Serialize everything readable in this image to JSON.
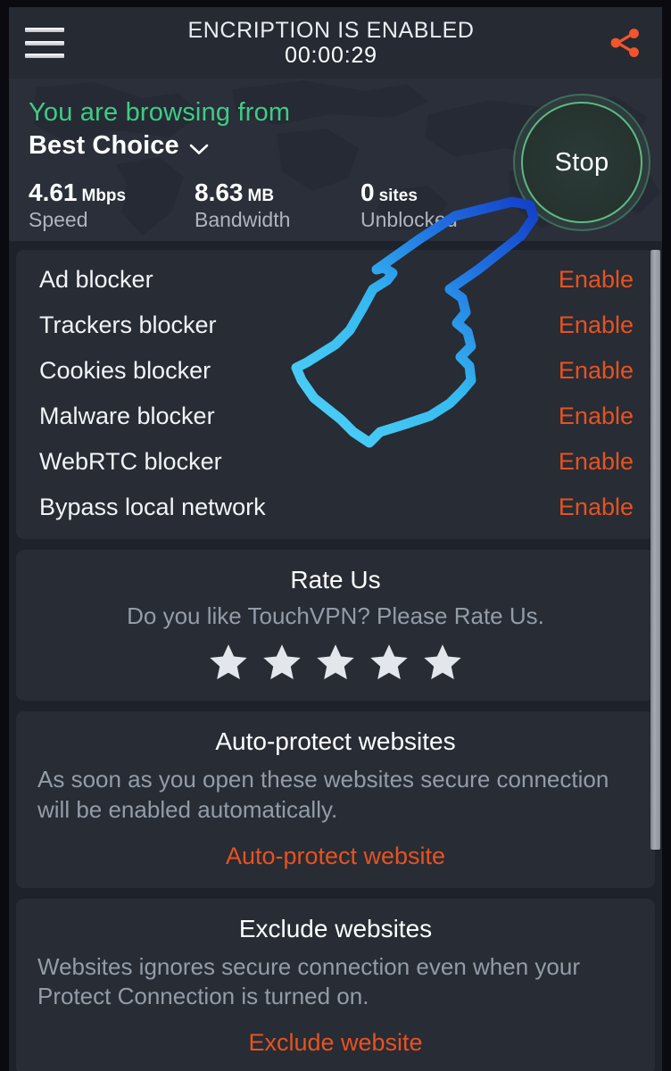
{
  "topbar": {
    "menu_icon": "hamburger-menu-icon",
    "title": "ENCRIPTION IS ENABLED",
    "timer": "00:00:29",
    "share_icon": "share-icon"
  },
  "status": {
    "browsing_from_label": "You are browsing from",
    "location": "Best Choice",
    "chevron_icon": "chevron-down-icon",
    "stop_button": "Stop",
    "stats": [
      {
        "value": "4.61",
        "unit": "Mbps",
        "label": "Speed"
      },
      {
        "value": "8.63",
        "unit": "MB",
        "label": "Bandwidth"
      },
      {
        "value": "0",
        "unit": "sites",
        "label": "Unblocked"
      }
    ]
  },
  "blockers": [
    {
      "name": "Ad blocker",
      "action": "Enable"
    },
    {
      "name": "Trackers blocker",
      "action": "Enable"
    },
    {
      "name": "Cookies blocker",
      "action": "Enable"
    },
    {
      "name": "Malware blocker",
      "action": "Enable"
    },
    {
      "name": "WebRTC blocker",
      "action": "Enable"
    },
    {
      "name": "Bypass local network",
      "action": "Enable"
    }
  ],
  "rate_us": {
    "title": "Rate Us",
    "subtitle": "Do you like TouchVPN? Please Rate Us.",
    "stars_total": 5,
    "stars_filled": 5
  },
  "auto_protect": {
    "title": "Auto-protect websites",
    "description": "As soon as you open these websites secure connection will be enabled automatically.",
    "link": "Auto-protect website"
  },
  "exclude": {
    "title": "Exclude websites",
    "description": "Websites ignores secure connection even when your Protect Connection is turned on.",
    "link": "Exclude website"
  },
  "overlay": {
    "cursor_icon": "pointing-hand-cursor-icon"
  },
  "colors": {
    "accent_orange": "#e8521f",
    "accent_green": "#3ecc84",
    "stop_ring": "#5fb887",
    "card_bg": "#272c35",
    "screen_bg": "#1d222b",
    "topbar_bg": "#252a33"
  }
}
